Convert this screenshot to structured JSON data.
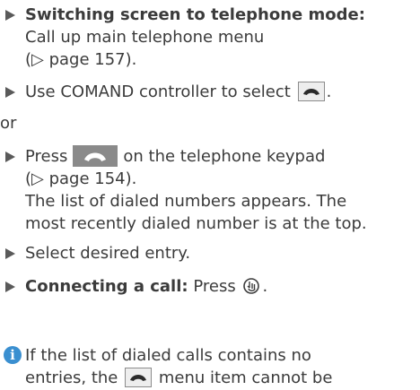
{
  "steps": [
    {
      "lead": "Switching screen to telephone mode:",
      "lines": [
        "Call up main telephone menu",
        "(▷ page 157)."
      ]
    },
    {
      "before": "Use COMAND controller to select",
      "after": "."
    },
    {
      "before": "Press",
      "after": "on the telephone keypad",
      "lines": [
        "(▷ page 154).",
        "The list of dialed numbers appears. The",
        "most recently dialed number is at the top."
      ]
    },
    {
      "text": "Select desired entry."
    },
    {
      "lead": "Connecting a call:",
      "before": "Press",
      "after": "."
    }
  ],
  "or_text": "or",
  "info": {
    "icon_char": "i",
    "line1": "If the list of dialed calls contains no",
    "before": "entries, the",
    "after": "menu item cannot be"
  },
  "icons": {
    "bullet": "triangle-bullet-icon",
    "phone_key": "telephone-handset-icon",
    "dial_key": "dial-key-icon",
    "controller": "comand-controller-press-icon",
    "info": "info-icon"
  }
}
